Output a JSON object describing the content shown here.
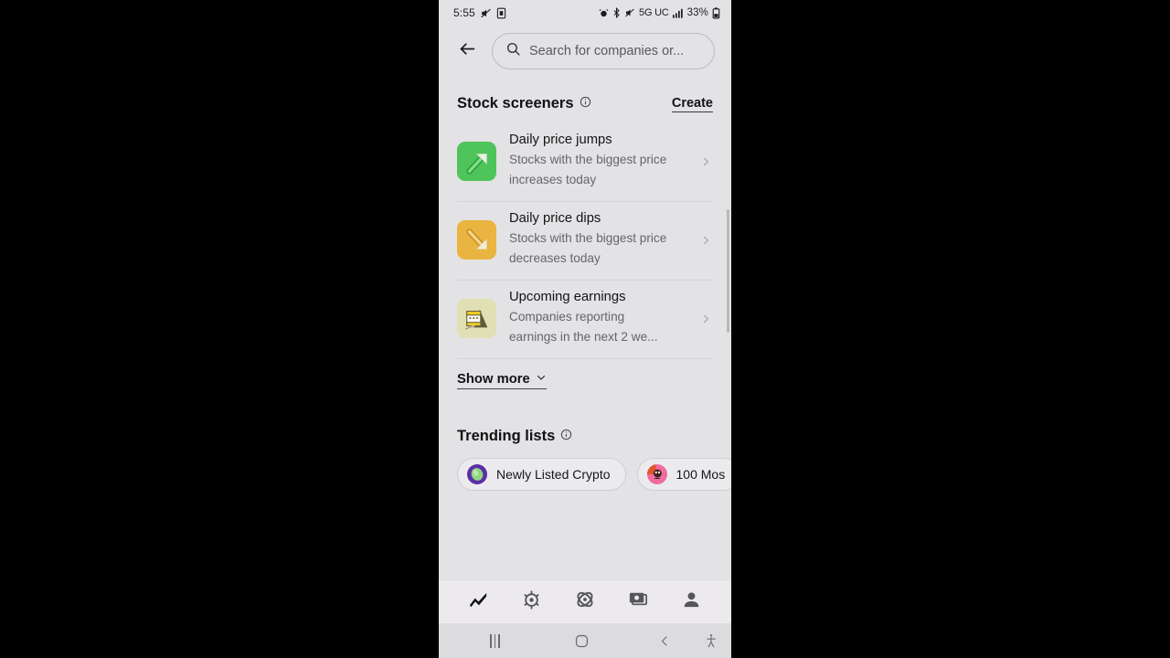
{
  "status_bar": {
    "time": "5:55",
    "left_icons": [
      "mute-icon",
      "sim-card-icon"
    ],
    "right_icons": [
      "alarm-icon",
      "bluetooth-icon",
      "vibrate-off-icon"
    ],
    "network": "5G UC",
    "signal": "signal-bars-icon",
    "battery_percent": "33%",
    "battery_icon": "battery-icon"
  },
  "search": {
    "back_icon": "back-arrow-icon",
    "search_icon": "search-icon",
    "placeholder": "Search for companies or..."
  },
  "screeners": {
    "title": "Stock screeners",
    "info_icon": "info-icon",
    "create_label": "Create",
    "items": [
      {
        "icon_name": "green-up-arrow-tile-icon",
        "title": "Daily price jumps",
        "subtitle": "Stocks with the biggest price increases today",
        "tile_color": "#4ec45a",
        "chevron_icon": "chevron-right-icon"
      },
      {
        "icon_name": "orange-down-arrow-tile-icon",
        "title": "Daily price dips",
        "subtitle": "Stocks with the biggest price decreases today",
        "tile_color": "#eab440",
        "chevron_icon": "chevron-right-icon"
      },
      {
        "icon_name": "calendar-tile-icon",
        "title": "Upcoming earnings",
        "subtitle": "Companies reporting earnings in the next 2 we...",
        "tile_color": "#e1dfb4",
        "chevron_icon": "chevron-right-icon"
      }
    ],
    "show_more_label": "Show more",
    "show_more_icon": "chevron-down-icon"
  },
  "trending": {
    "title": "Trending lists",
    "info_icon": "info-icon",
    "chips": [
      {
        "label": "Newly Listed Crypto",
        "icon_name": "crypto-avatar-icon",
        "icon_color": "#5b2ea8"
      },
      {
        "label": "100 Mos",
        "icon_name": "pink-avatar-icon",
        "icon_color": "#f06ba0"
      }
    ]
  },
  "app_nav": {
    "items": [
      {
        "name": "tab-markets",
        "icon_name": "line-chart-icon",
        "active": true
      },
      {
        "name": "tab-crypto",
        "icon_name": "crypto-coin-icon",
        "active": false
      },
      {
        "name": "tab-discover",
        "icon_name": "atom-orbit-icon",
        "active": false
      },
      {
        "name": "tab-cash",
        "icon_name": "banknote-icon",
        "active": false
      },
      {
        "name": "tab-account",
        "icon_name": "person-icon",
        "active": false
      }
    ]
  },
  "system_nav": {
    "recent_icon": "recent-apps-icon",
    "home_icon": "home-icon",
    "back_icon": "back-icon",
    "accessibility_icon": "accessibility-icon"
  },
  "colors": {
    "background": "#e3e2e4",
    "nav_background": "#eceaec",
    "system_nav_background": "#dcdbdd",
    "text_primary": "#121214",
    "text_secondary": "#65656a"
  }
}
